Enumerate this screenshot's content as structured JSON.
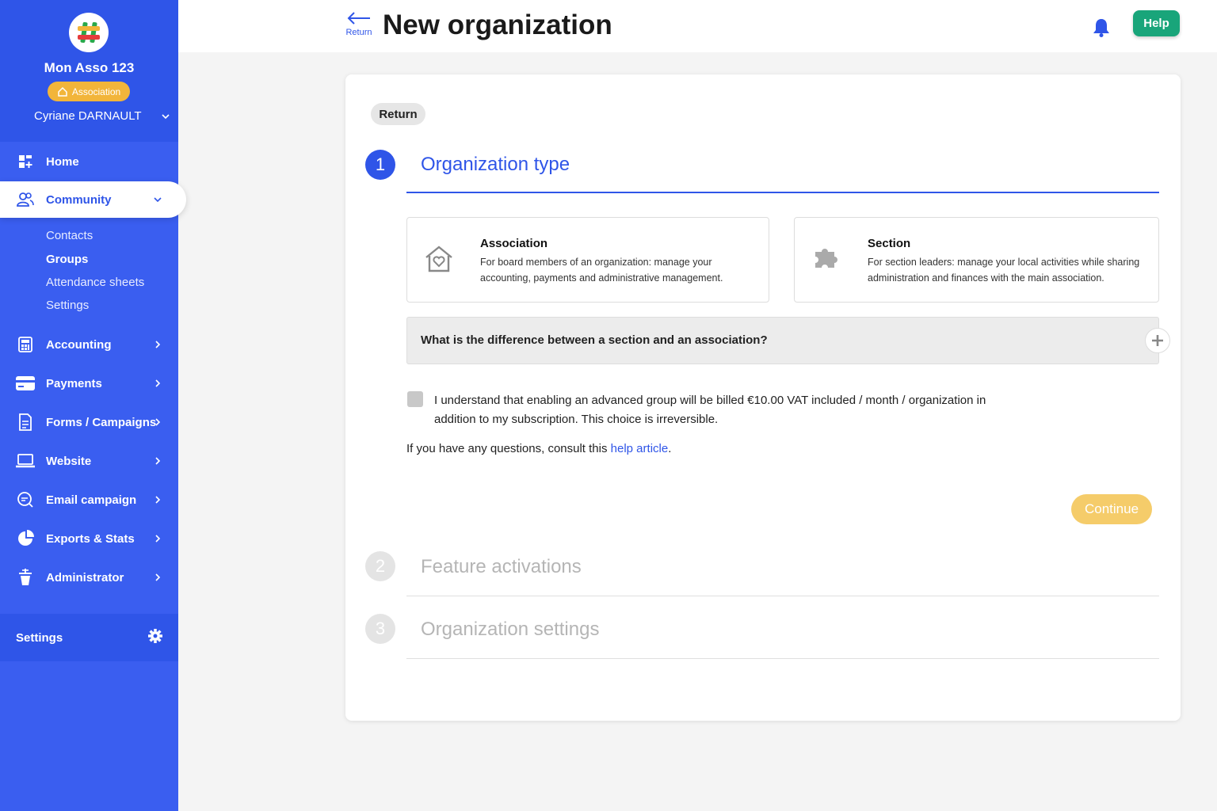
{
  "sidebar": {
    "org_name": "Mon Asso 123",
    "org_badge": "Association",
    "user_name": "Cyriane DARNAULT",
    "nav": [
      {
        "label": "Home",
        "icon": "dashboard-icon"
      },
      {
        "label": "Community",
        "icon": "users-icon"
      },
      {
        "label": "Accounting",
        "icon": "calculator-icon"
      },
      {
        "label": "Payments",
        "icon": "credit-card-icon"
      },
      {
        "label": "Forms / Campaigns",
        "icon": "document-icon"
      },
      {
        "label": "Website",
        "icon": "laptop-icon"
      },
      {
        "label": "Email campaign",
        "icon": "chat-icon"
      },
      {
        "label": "Exports & Stats",
        "icon": "pie-chart-icon"
      },
      {
        "label": "Administrator",
        "icon": "admin-icon"
      }
    ],
    "community_sub": [
      "Contacts",
      "Groups",
      "Attendance sheets",
      "Settings"
    ],
    "settings_label": "Settings"
  },
  "header": {
    "back_label": "Return",
    "title": "New organization",
    "help_label": "Help"
  },
  "card": {
    "return_label": "Return",
    "steps": [
      {
        "num": "1",
        "title": "Organization type"
      },
      {
        "num": "2",
        "title": "Feature activations"
      },
      {
        "num": "3",
        "title": "Organization settings"
      }
    ],
    "options": [
      {
        "title": "Association",
        "desc": "For board members of an organization: manage your accounting, payments and administrative management."
      },
      {
        "title": "Section",
        "desc": "For section leaders: manage your local activities while sharing administration and finances with the main association."
      }
    ],
    "faq_question": "What is the difference between a section and an association?",
    "ack_text": "I understand that enabling an advanced group will be billed €10.00 VAT included / month / organization in addition to my subscription. This choice is irreversible.",
    "help_prefix": "If you have any questions, consult this ",
    "help_link": "help article",
    "help_suffix": ".",
    "continue_label": "Continue"
  },
  "colors": {
    "brand_blue": "#2f55e8",
    "sidebar_blue": "#3a5ef0",
    "help_green": "#19a57a",
    "continue_yellow": "#f5cc6a",
    "badge_orange": "#f2b53a"
  }
}
